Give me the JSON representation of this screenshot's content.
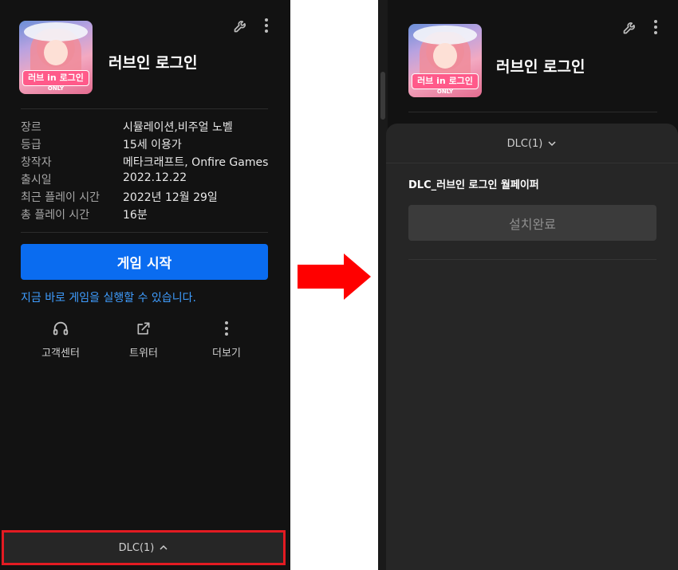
{
  "left": {
    "game_title": "러브인 로그인",
    "thumbnail": {
      "logo_text": "러브 in 로그인",
      "badge": "ONLY"
    },
    "info": [
      {
        "key": "장르",
        "value": "시뮬레이션,비주얼 노벨"
      },
      {
        "key": "등급",
        "value": "15세 이용가"
      },
      {
        "key": "창작자",
        "value": "메타크래프트, Onfire Games"
      },
      {
        "key": "출시일",
        "value": "2022.12.22"
      },
      {
        "key": "최근 플레이 시간",
        "value": "2022년 12월 29일"
      },
      {
        "key": "총 플레이 시간",
        "value": "16분"
      }
    ],
    "play_button_label": "게임 시작",
    "play_status": "지금 바로 게임을 실행할 수 있습니다.",
    "actions": [
      {
        "label": "고객센터",
        "icon": "headset-icon"
      },
      {
        "label": "트위터",
        "icon": "external-link-icon"
      },
      {
        "label": "더보기",
        "icon": "more-vertical-icon"
      }
    ],
    "dlc_bar_label": "DLC(1)"
  },
  "right": {
    "game_title": "러브인 로그인",
    "dlc_header_label": "DLC(1)",
    "dlc_items": [
      {
        "name": "DLC_러브인 로그인 월페이퍼",
        "status_label": "설치완료"
      }
    ]
  },
  "colors": {
    "panel_bg": "#121212",
    "sheet_bg": "#262626",
    "primary": "#0a6cf0",
    "link": "#3f9dff",
    "highlight_border": "#e21b22",
    "arrow": "#ff0000"
  }
}
